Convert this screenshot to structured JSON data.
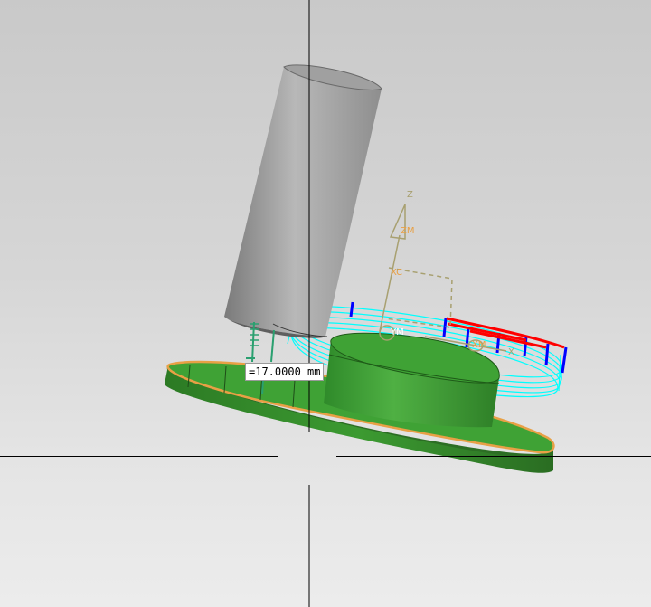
{
  "viewport": {
    "background_top": "#c9c9c9",
    "background_bottom": "#ececec"
  },
  "dimension": {
    "value_text": "=17.0000 mm"
  },
  "wcs": {
    "z_label": "Z",
    "zm_label": "ZM",
    "xc_label": "XC",
    "ym_label": "YM",
    "xm_label": "XM",
    "x_label": "X"
  },
  "colors": {
    "tool": "#9c9c9c",
    "part": "#3f9e34",
    "part_edge": "#e8a045",
    "toolpath": "#00ffff",
    "engage": "#0000ff",
    "retract": "#ff0000",
    "csys": "#a8a070",
    "crosshair": "#000000"
  },
  "icons": [
    "crosshair-icon",
    "csys-triad-icon"
  ]
}
